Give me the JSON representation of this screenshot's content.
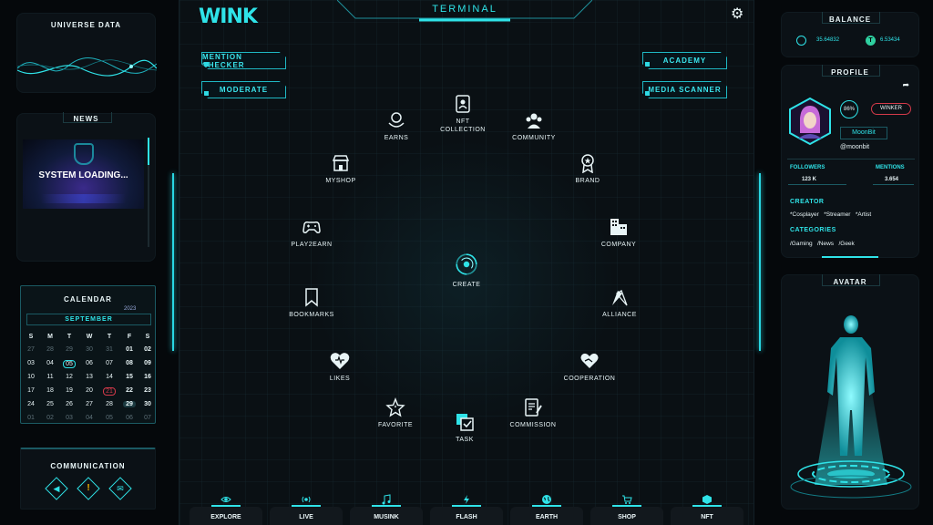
{
  "universe": {
    "title": "UNIVERSE DATA"
  },
  "news": {
    "title": "NEWS",
    "banner": "SYSTEM LOADING..."
  },
  "calendar": {
    "title": "CALENDAR",
    "year": "2023",
    "month": "SEPTEMBER",
    "weekdays": [
      "S",
      "M",
      "T",
      "W",
      "T",
      "F",
      "S"
    ],
    "rows": [
      [
        "27",
        "28",
        "29",
        "30",
        "31",
        "01",
        "02"
      ],
      [
        "03",
        "04",
        "05",
        "06",
        "07",
        "08",
        "09"
      ],
      [
        "10",
        "11",
        "12",
        "13",
        "14",
        "15",
        "16"
      ],
      [
        "17",
        "18",
        "19",
        "20",
        "21",
        "22",
        "23"
      ],
      [
        "24",
        "25",
        "26",
        "27",
        "28",
        "29",
        "30"
      ],
      [
        "01",
        "02",
        "03",
        "04",
        "05",
        "06",
        "07"
      ]
    ]
  },
  "communication": {
    "title": "COMMUNICATION"
  },
  "header": {
    "logo": "WINK",
    "terminal": "TERMINAL"
  },
  "buttons": {
    "mention_checker": "MENTION CHECKER",
    "moderate": "MODERATE",
    "academy": "ACADEMY",
    "media_scanner": "MEDIA SCANNER"
  },
  "nodes": {
    "nft": "NFT COLLECTION",
    "earns": "EARNS",
    "community": "COMMUNITY",
    "myshop": "MYSHOP",
    "brand": "BRAND",
    "play2earn": "PLAY2EARN",
    "company": "COMPANY",
    "create": "CREATE",
    "bookmarks": "BOOKMARKS",
    "alliance": "ALLIANCE",
    "likes": "LIKES",
    "cooperation": "COOPERATION",
    "favorite": "FAVORITE",
    "commission": "COMMISSION",
    "task": "TASK"
  },
  "bottom_nav": {
    "explore": "EXPLORE",
    "live": "LIVE",
    "musink": "MUSINK",
    "flash": "FLASH",
    "earth": "EARTH",
    "shop": "SHOP",
    "nft": "NFT"
  },
  "balance": {
    "title": "BALANCE",
    "value1": "35.64832",
    "value2": "6.53434"
  },
  "profile": {
    "title": "PROFILE",
    "percent": "86%",
    "badge": "WINKER",
    "name": "MoonBit",
    "handle": "@moonbit",
    "followers_label": "FOLLOWERS",
    "followers_value": "123 K",
    "mentions_label": "MENTIONS",
    "mentions_value": "3.654",
    "creator_label": "CREATOR",
    "creator_tags": "*Cosplayer   *Streamer   *Artist",
    "categories_label": "CATEGORIES",
    "categories_tags": "/Gaming   /News   /Geek"
  },
  "avatar": {
    "title": "AVATAR"
  },
  "colors": {
    "accent": "#2fe3e8",
    "background": "#05080b",
    "panel": "#0b1116",
    "highlight_red": "#d43a4a"
  }
}
